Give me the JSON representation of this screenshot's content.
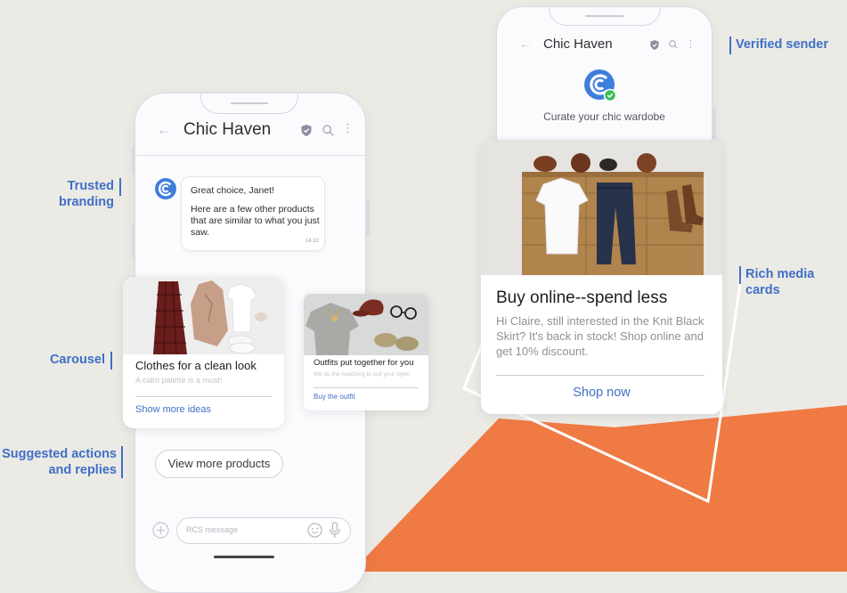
{
  "labels": {
    "trusted_branding": "Trusted branding",
    "carousel": "Carousel",
    "suggested_actions_1": "Suggested actions",
    "suggested_actions_2": "and replies",
    "verified_sender": "Verified sender",
    "rich_media_cards": "Rich media cards"
  },
  "left_phone": {
    "header_title": "Chic Haven",
    "message": {
      "line1": "Great choice, Janet!",
      "line2": "Here are a few other products that are similar to what you just saw.",
      "time": "14:22"
    },
    "carousel": [
      {
        "title": "Clothes for a clean look",
        "subtitle": "A calm palette is a must!",
        "action": "Show more ideas"
      },
      {
        "title": "Outfits put together for you",
        "subtitle": "We do the matching to suit your style!",
        "action": "Buy the outfit"
      }
    ],
    "suggested_reply": "View more products",
    "composer_placeholder": "RCS message"
  },
  "right_phone": {
    "header_title": "Chic Haven",
    "tagline": "Curate your chic wardobe",
    "card": {
      "title": "Buy online--spend less",
      "body": "Hi Claire, still interested in the Knit Black Skirt? It's back in stock! Shop online and get 10% discount.",
      "action": "Shop now"
    }
  },
  "colors": {
    "accent": "#3f6fc7",
    "orange": "#ef7a43",
    "background": "#ebeae4",
    "verified_green": "#3bbf58"
  }
}
